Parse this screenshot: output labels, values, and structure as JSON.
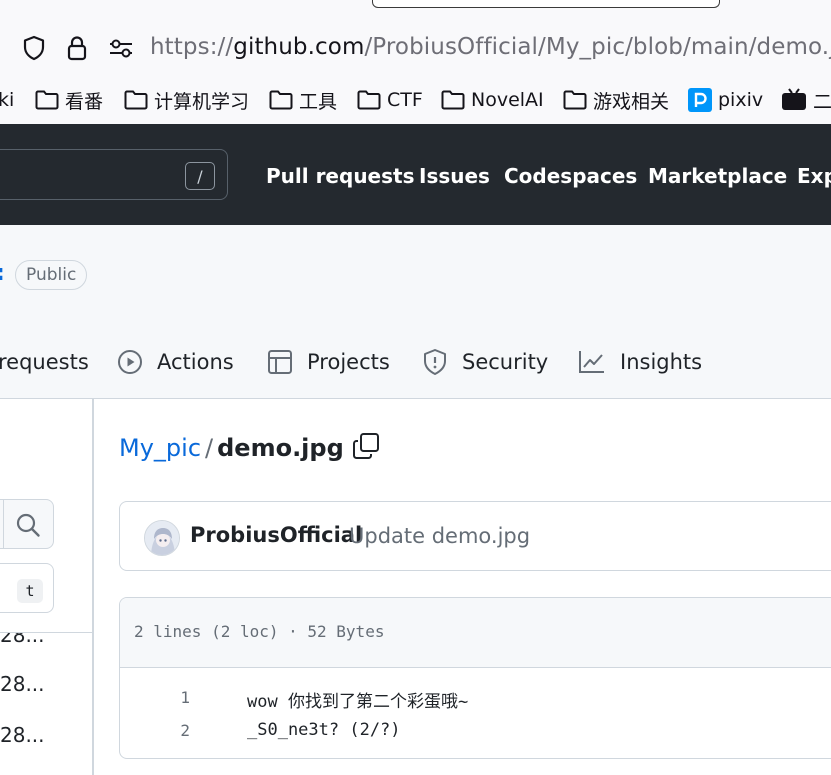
{
  "browser": {
    "url_prefix": "https://",
    "url_host": "github.com",
    "url_path": "/ProbiusOfficial/My_pic/blob/main/demo.jpg",
    "bookmarks": [
      {
        "label": "ki"
      },
      {
        "label": "看番"
      },
      {
        "label": "计算机学习"
      },
      {
        "label": "工具"
      },
      {
        "label": "CTF"
      },
      {
        "label": "NovelAI"
      },
      {
        "label": "游戏相关"
      },
      {
        "label": "pixiv"
      },
      {
        "label": "二"
      }
    ]
  },
  "header": {
    "search_shortcut": "/",
    "nav": [
      "Pull requests",
      "Issues",
      "Codespaces",
      "Marketplace",
      "Exp"
    ]
  },
  "repo": {
    "name_tail": ":",
    "visibility": "Public",
    "tabs": [
      "requests",
      "Actions",
      "Projects",
      "Security",
      "Insights"
    ]
  },
  "file_tree": {
    "filter_shortcut": "t",
    "items": [
      "28...",
      "28...",
      "28..."
    ]
  },
  "breadcrumb": {
    "repo": "My_pic",
    "separator": "/",
    "file": "demo.jpg"
  },
  "commit": {
    "author": "ProbiusOfficial",
    "message": "Update demo.jpg"
  },
  "file": {
    "meta": "2 lines (2 loc) · 52 Bytes",
    "lines": [
      {
        "num": "1",
        "code": "wow 你找到了第二个彩蛋哦~"
      },
      {
        "num": "2",
        "code": "_S0_ne3t? (2/?)"
      }
    ]
  },
  "colors": {
    "header_bg": "#24292f",
    "link": "#0969da",
    "border": "#d0d7de",
    "muted": "#656d76"
  }
}
